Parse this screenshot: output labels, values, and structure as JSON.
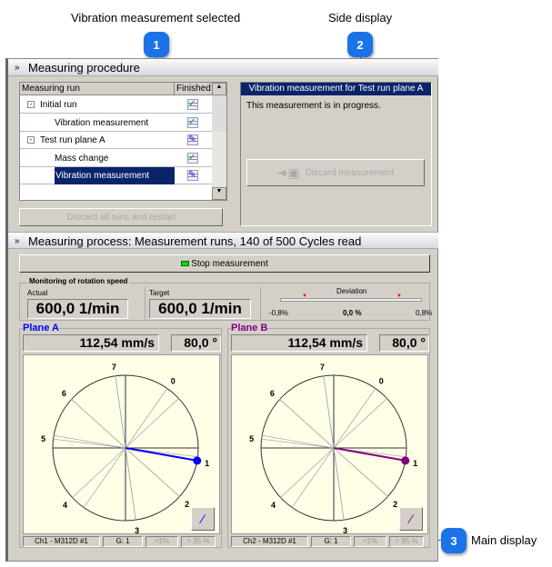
{
  "callouts": [
    {
      "number": "1",
      "label": "Vibration measurement selected"
    },
    {
      "number": "2",
      "label": "Side display"
    },
    {
      "number": "3",
      "label": "Main display"
    }
  ],
  "procedure": {
    "title": "Measuring procedure",
    "columns": [
      "Measuring run",
      "Finished"
    ],
    "rows": [
      {
        "label": "Initial run",
        "status": "done"
      },
      {
        "label": "Vibration measurement",
        "status": "done"
      },
      {
        "label": "Test run plane A",
        "status": "in-progress"
      },
      {
        "label": "Mass change",
        "status": "done"
      },
      {
        "label": "Vibration measurement",
        "status": "in-progress"
      }
    ],
    "discard_all": "Discard all runs and restart",
    "side": {
      "title": "Vibration measurement for Test run plane A",
      "text": "This measurement is in progress.",
      "discard": "Discard measurement"
    }
  },
  "process": {
    "title": "Measuring process: Measurement runs, 140 of 500 Cycles read",
    "stop": "Stop measurement",
    "monitor_title": "Monitoring of rotation speed",
    "actual_label": "Actual",
    "actual": "600,0 1/min",
    "target_label": "Target",
    "target": "600,0 1/min",
    "deviation_label": "Deviation",
    "dev_min": "-0,8%",
    "dev_value": "0,0 %",
    "dev_max": "0,8%"
  },
  "planes": [
    {
      "title": "Plane A",
      "color": "#0000ff",
      "magnitude": "112,54 mm/s",
      "angle": "80,0 °",
      "angle_deg": 80,
      "channel": "Ch1 - M312D #1",
      "gain": "G: 1",
      "lt": "<1%",
      "gt": "> 95 %"
    },
    {
      "title": "Plane B",
      "color": "#800080",
      "magnitude": "112,54 mm/s",
      "angle": "80,0 °",
      "angle_deg": 80,
      "channel": "Ch2 - M312D #1",
      "gain": "G: 1",
      "lt": "<1%",
      "gt": "> 95 %"
    }
  ],
  "chart_data": {
    "type": "polar",
    "positions": [
      "0",
      "1",
      "2",
      "3",
      "4",
      "5",
      "6",
      "7"
    ],
    "position_angles_deg": [
      35,
      100,
      132,
      172,
      227,
      277,
      312,
      352
    ]
  }
}
